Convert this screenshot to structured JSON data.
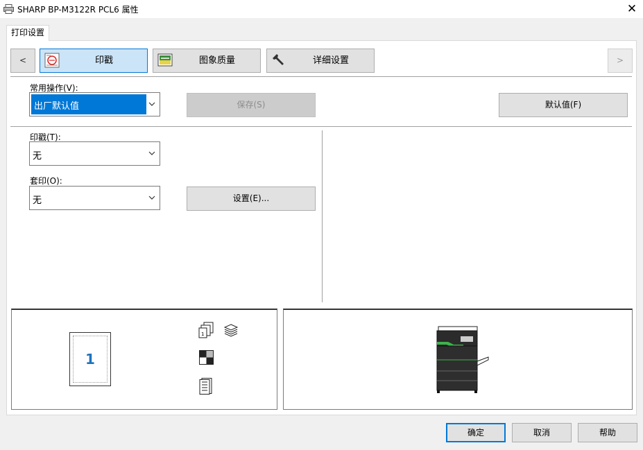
{
  "window": {
    "title": "SHARP BP-M3122R PCL6 属性",
    "close_symbol": "✕"
  },
  "tabs": [
    {
      "label": "打印设置"
    }
  ],
  "nav": {
    "prev_symbol": "<",
    "next_symbol": ">"
  },
  "categories": [
    {
      "label": "印戳",
      "icon": "stamp-icon",
      "selected": true
    },
    {
      "label": "图象质量",
      "icon": "image-quality-icon",
      "selected": false
    },
    {
      "label": "详细设置",
      "icon": "wrench-icon",
      "selected": false
    }
  ],
  "common_ops": {
    "label": "常用操作(V):",
    "value": "出厂默认值"
  },
  "save_button": {
    "label": "保存(S)",
    "enabled": false
  },
  "defaults_button": {
    "label": "默认值(F)"
  },
  "stamp": {
    "label": "印戳(T):",
    "value": "无"
  },
  "overlay": {
    "label": "套印(O):",
    "value": "无"
  },
  "settings_button": {
    "label": "设置(E)..."
  },
  "preview": {
    "page_number": "1"
  },
  "footer": {
    "ok": "确定",
    "cancel": "取消",
    "help": "帮助"
  },
  "colors": {
    "accent": "#0078d7",
    "selected_fill": "#cce4f7",
    "page_number": "#1e73be",
    "printer_green": "#3cb44b"
  }
}
